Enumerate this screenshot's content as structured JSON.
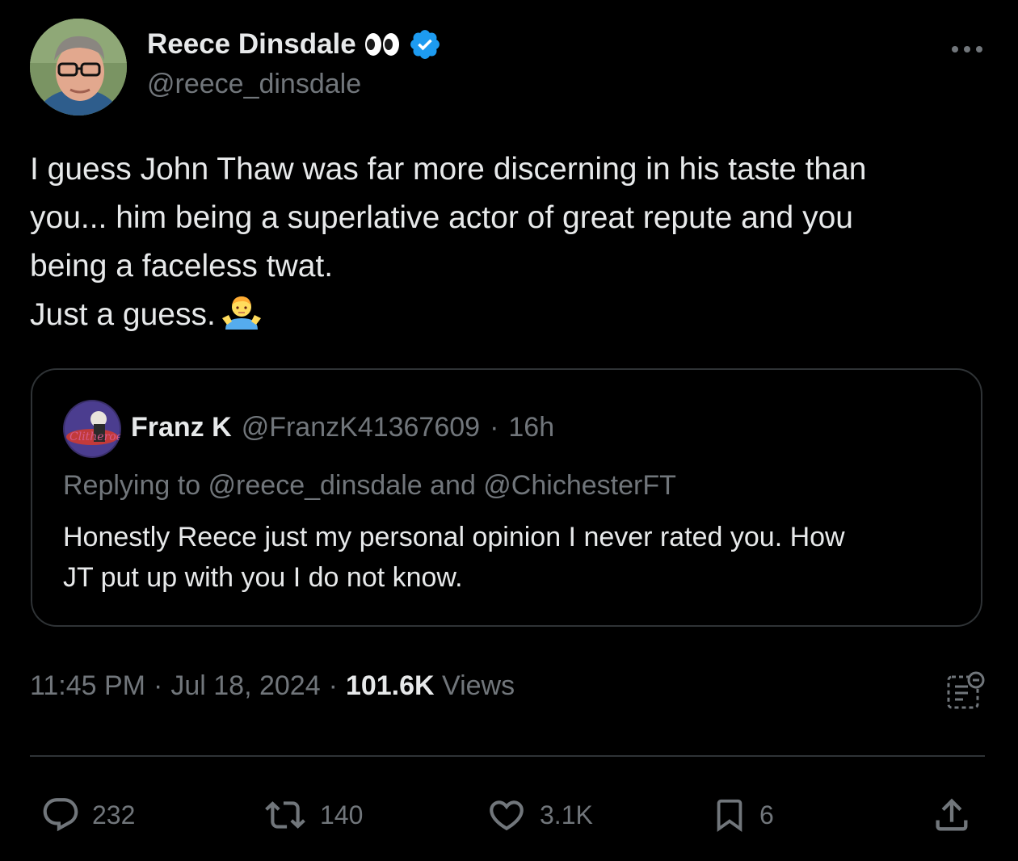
{
  "author": {
    "name": "Reece Dinsdale",
    "handle": "@reece_dinsdale",
    "avatar_icon": "person-glasses-avatar",
    "name_emoji": "eyes-icon",
    "verified_color": "#1d9bf0"
  },
  "tweet": {
    "lines": [
      "I guess John Thaw was far more discerning in his taste than",
      "you... him being a superlative actor of great repute and you",
      "being a faceless twat.",
      "Just a guess."
    ],
    "emoji": "person-shrugging-icon"
  },
  "quote": {
    "name": "Franz K",
    "handle": "@FranzK41367609",
    "separator": "·",
    "time": "16h",
    "replying_to": "Replying to @reece_dinsdale and @ChichesterFT",
    "lines": [
      "Honestly Reece just my personal opinion I never rated you. How",
      "JT put up with you I do not know."
    ]
  },
  "meta": {
    "time": "11:45 PM",
    "sep1": "·",
    "date": "Jul 18, 2024",
    "sep2": "·",
    "views_count": "101.6K",
    "views_label": "Views"
  },
  "actions": {
    "replies": "232",
    "reposts": "140",
    "likes": "3.1K",
    "bookmarks": "6"
  },
  "colors": {
    "background": "#000000",
    "text": "#e7e9ea",
    "muted": "#71767b",
    "border": "#2f3336",
    "accent": "#1d9bf0"
  }
}
